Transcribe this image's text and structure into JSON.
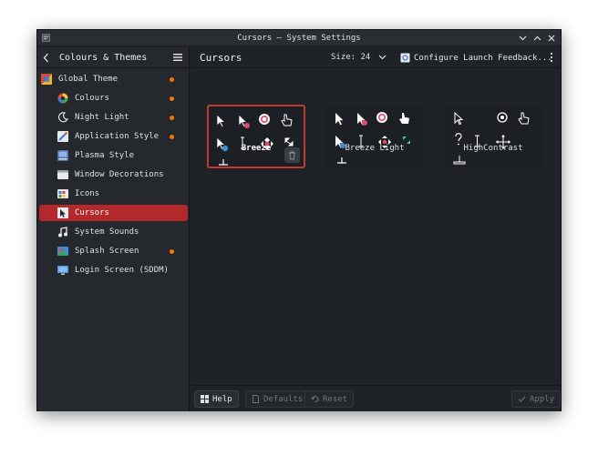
{
  "window": {
    "title": "Cursors — System Settings"
  },
  "sidebar": {
    "header": "Colours & Themes",
    "items": [
      {
        "label": "Global Theme",
        "dot": true
      },
      {
        "label": "Colours",
        "dot": true
      },
      {
        "label": "Night Light",
        "dot": true
      },
      {
        "label": "Application Style",
        "dot": true
      },
      {
        "label": "Plasma Style",
        "dot": false
      },
      {
        "label": "Window Decorations",
        "dot": false
      },
      {
        "label": "Icons",
        "dot": false
      },
      {
        "label": "Cursors",
        "dot": false,
        "active": true
      },
      {
        "label": "System Sounds",
        "dot": false
      },
      {
        "label": "Splash Screen",
        "dot": true
      },
      {
        "label": "Login Screen (SDDM)",
        "dot": false
      }
    ]
  },
  "main": {
    "title": "Cursors",
    "size_label": "Size: 24",
    "launch_feedback_label": "Configure Launch Feedback..."
  },
  "themes": [
    {
      "name": "Breeze",
      "selected": true
    },
    {
      "name": "Breeze Light",
      "selected": false
    },
    {
      "name": "HighContrast",
      "selected": false
    }
  ],
  "footer": {
    "help": "Help",
    "defaults": "Defaults",
    "reset": "Reset",
    "apply": "Apply"
  },
  "colors": {
    "accent": "#b3282a",
    "selection_border": "#c13a32",
    "dot": "#f67400",
    "background": "#1f2226"
  }
}
